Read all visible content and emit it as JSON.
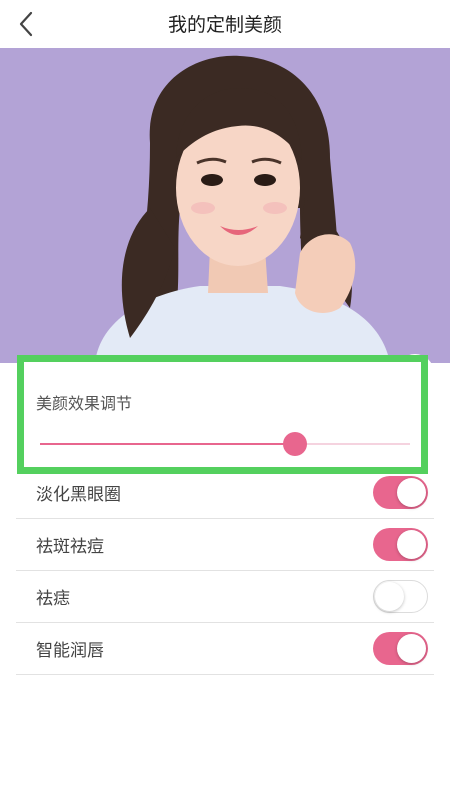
{
  "header": {
    "title": "我的定制美颜",
    "back_icon": "chevron-left-icon"
  },
  "photo": {
    "background_color": "#b3a3d6",
    "reset_label": "重置",
    "crop_icon": "crop-icon"
  },
  "adjust": {
    "label": "美颜效果调节",
    "value_percent": 69
  },
  "options": [
    {
      "label": "淡化黑眼圈",
      "on": true
    },
    {
      "label": "祛斑祛痘",
      "on": true
    },
    {
      "label": "祛痣",
      "on": false
    },
    {
      "label": "智能润唇",
      "on": true
    }
  ],
  "colors": {
    "accent": "#e8668e",
    "highlight_border": "#54d05e"
  }
}
